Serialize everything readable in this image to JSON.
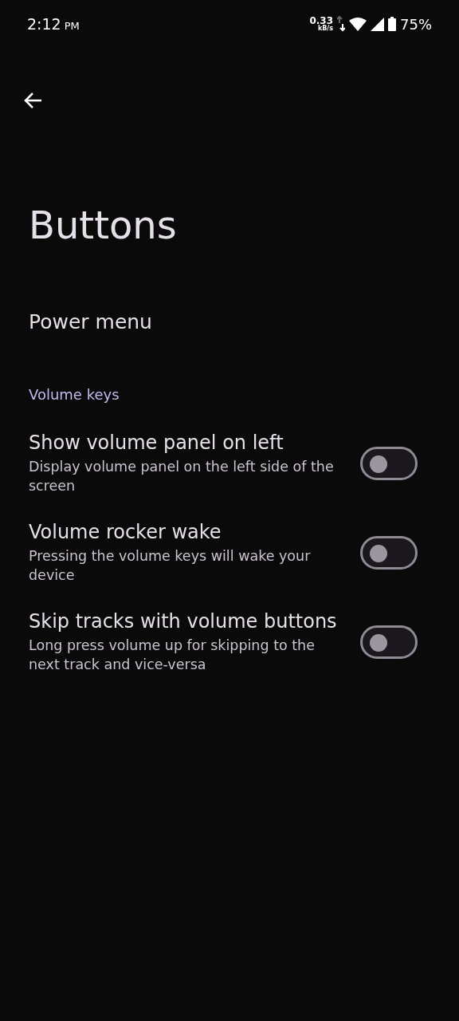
{
  "status_bar": {
    "time": "2:12",
    "ampm": "PM",
    "speed": "0.33",
    "speed_unit": "kB/s",
    "battery": "75%"
  },
  "title": "Buttons",
  "items": [
    {
      "kind": "link",
      "title": "Power menu"
    },
    {
      "kind": "header",
      "title": "Volume keys"
    },
    {
      "kind": "toggle",
      "title": "Show volume panel on left",
      "summary": "Display volume panel on the left side of the screen",
      "on": false
    },
    {
      "kind": "toggle",
      "title": "Volume rocker wake",
      "summary": "Pressing the volume keys will wake your device",
      "on": false
    },
    {
      "kind": "toggle",
      "title": "Skip tracks with volume buttons",
      "summary": "Long press volume up for skipping to the next track and vice-versa",
      "on": false
    }
  ]
}
